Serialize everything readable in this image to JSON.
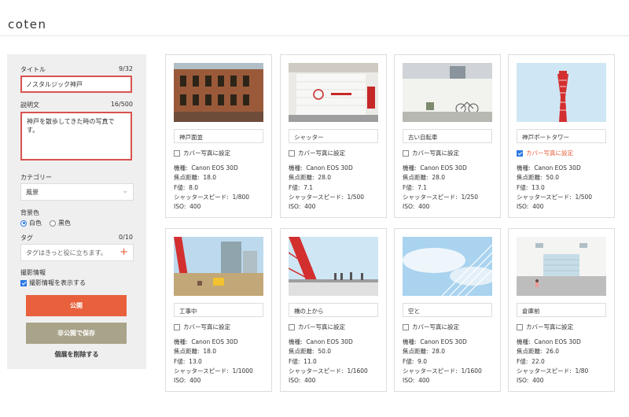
{
  "app": {
    "logo": "coten"
  },
  "sidebar": {
    "title_label": "タイトル",
    "title_count": "9/32",
    "title_value": "ノスタルジック神戸",
    "desc_label": "説明文",
    "desc_count": "16/500",
    "desc_value": "神戸を散歩してきた時の写真です。",
    "category_label": "カテゴリー",
    "category_value": "風景",
    "bg_label": "背景色",
    "bg_options": [
      "白色",
      "黒色"
    ],
    "bg_selected": "白色",
    "tag_label": "タグ",
    "tag_count": "0/10",
    "tag_placeholder": "タグはきっと役に立ちます。",
    "shoot_label": "撮影情報",
    "shoot_checkbox": "撮影情報を表示する",
    "publish_button": "公開",
    "private_button": "非公開で保存",
    "delete_link": "個展を削除する"
  },
  "labels": {
    "cover": "カバー写真に設定",
    "model": "機種:",
    "focal": "焦点距離:",
    "fnum": "F値:",
    "shutter": "シャッタースピード:",
    "iso": "ISO:"
  },
  "photos": [
    {
      "caption": "神戸面並",
      "cover": false,
      "model": "Canon EOS 30D",
      "focal": "18.0",
      "fnum": "8.0",
      "shutter": "1/800",
      "iso": "400",
      "scene": "building"
    },
    {
      "caption": "シャッター",
      "cover": false,
      "model": "Canon EOS 30D",
      "focal": "28.0",
      "fnum": "7.1",
      "shutter": "1/500",
      "iso": "400",
      "scene": "shutter"
    },
    {
      "caption": "古い自転車",
      "cover": false,
      "model": "Canon EOS 30D",
      "focal": "28.0",
      "fnum": "7.1",
      "shutter": "1/250",
      "iso": "400",
      "scene": "bicycle"
    },
    {
      "caption": "神戸ポートタワー",
      "cover": true,
      "model": "Canon EOS 30D",
      "focal": "50.0",
      "fnum": "13.0",
      "shutter": "1/500",
      "iso": "400",
      "scene": "tower"
    },
    {
      "caption": "工事中",
      "cover": false,
      "model": "Canon EOS 30D",
      "focal": "18.0",
      "fnum": "13.0",
      "shutter": "1/1000",
      "iso": "400",
      "scene": "construction"
    },
    {
      "caption": "橋の上から",
      "cover": false,
      "model": "Canon EOS 30D",
      "focal": "50.0",
      "fnum": "11.0",
      "shutter": "1/1600",
      "iso": "400",
      "scene": "bridge"
    },
    {
      "caption": "空と",
      "cover": false,
      "model": "Canon EOS 30D",
      "focal": "28.0",
      "fnum": "9.0",
      "shutter": "1/1600",
      "iso": "400",
      "scene": "sky"
    },
    {
      "caption": "倉庫前",
      "cover": false,
      "model": "Canon EOS 30D",
      "focal": "26.0",
      "fnum": "22.0",
      "shutter": "1/80",
      "iso": "400",
      "scene": "warehouse"
    }
  ],
  "colors": {
    "accent": "#e8603c",
    "secondary": "#a9a38a",
    "error_border": "#d9534f",
    "checkbox": "#2b78e4"
  }
}
